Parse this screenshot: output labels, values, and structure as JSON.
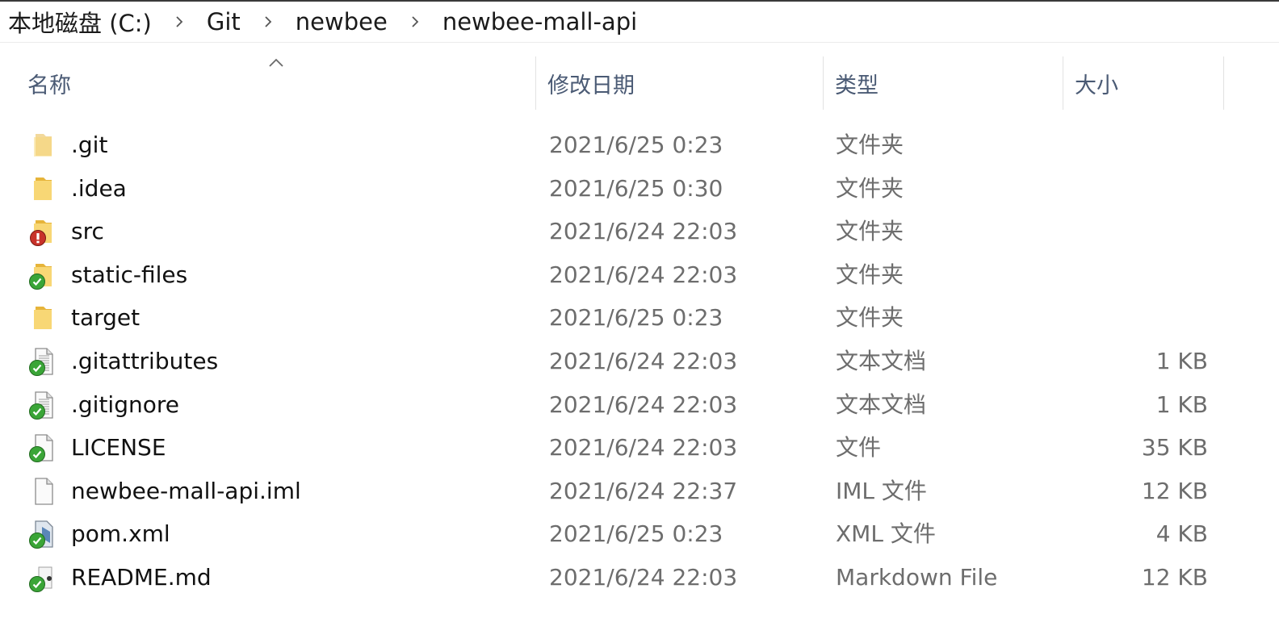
{
  "breadcrumb": [
    "本地磁盘 (C:)",
    "Git",
    "newbee",
    "newbee-mall-api"
  ],
  "columns": {
    "name": "名称",
    "modified": "修改日期",
    "type": "类型",
    "size": "大小"
  },
  "files": [
    {
      "name": ".git",
      "modified": "2021/6/25 0:23",
      "type": "文件夹",
      "size": "",
      "icon": "folder-hidden-icon"
    },
    {
      "name": ".idea",
      "modified": "2021/6/25 0:30",
      "type": "文件夹",
      "size": "",
      "icon": "folder-icon"
    },
    {
      "name": "src",
      "modified": "2021/6/24 22:03",
      "type": "文件夹",
      "size": "",
      "icon": "folder-modified-icon"
    },
    {
      "name": "static-files",
      "modified": "2021/6/24 22:03",
      "type": "文件夹",
      "size": "",
      "icon": "folder-committed-icon"
    },
    {
      "name": "target",
      "modified": "2021/6/25 0:23",
      "type": "文件夹",
      "size": "",
      "icon": "folder-icon"
    },
    {
      "name": ".gitattributes",
      "modified": "2021/6/24 22:03",
      "type": "文本文档",
      "size": "1 KB",
      "icon": "text-file-committed-icon"
    },
    {
      "name": ".gitignore",
      "modified": "2021/6/24 22:03",
      "type": "文本文档",
      "size": "1 KB",
      "icon": "text-file-committed-icon"
    },
    {
      "name": "LICENSE",
      "modified": "2021/6/24 22:03",
      "type": "文件",
      "size": "35 KB",
      "icon": "file-committed-icon"
    },
    {
      "name": "newbee-mall-api.iml",
      "modified": "2021/6/24 22:37",
      "type": "IML 文件",
      "size": "12 KB",
      "icon": "file-icon"
    },
    {
      "name": "pom.xml",
      "modified": "2021/6/25 0:23",
      "type": "XML 文件",
      "size": "4 KB",
      "icon": "xml-file-committed-icon"
    },
    {
      "name": "README.md",
      "modified": "2021/6/24 22:03",
      "type": "Markdown File",
      "size": "12 KB",
      "icon": "markdown-file-committed-icon"
    }
  ]
}
